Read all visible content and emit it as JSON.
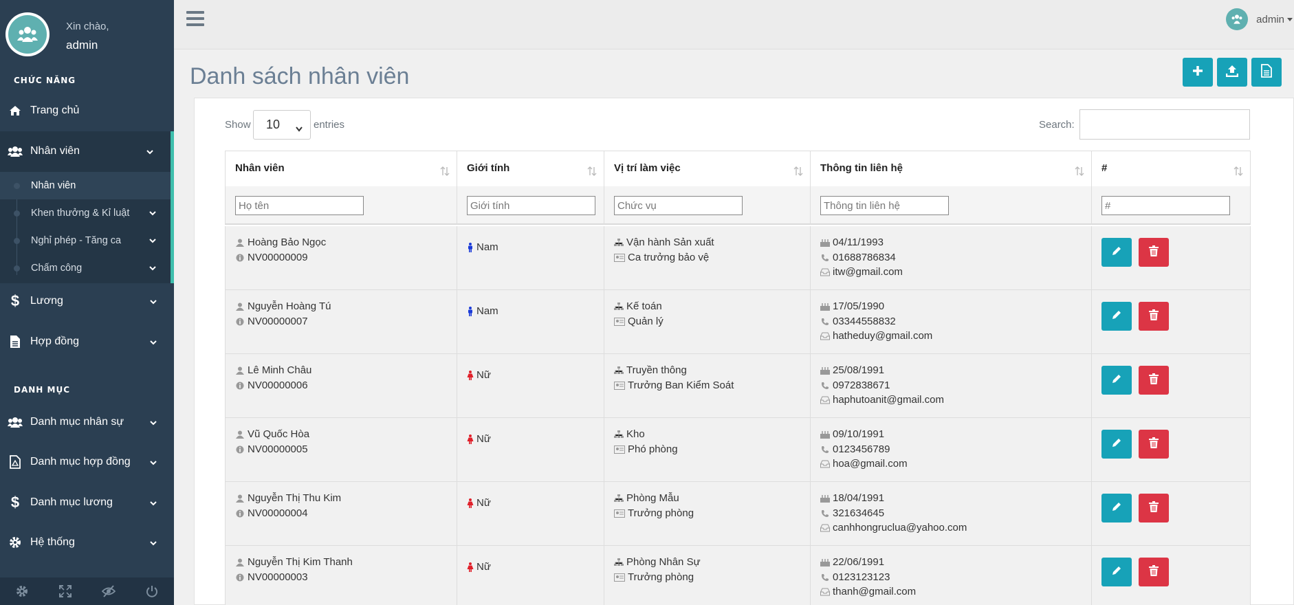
{
  "colors": {
    "sidebar": "#2b3f52",
    "accent": "#17a2b8",
    "danger": "#dc3545",
    "active_border": "#3fbfad"
  },
  "sidebar": {
    "greeting": "Xin chào,",
    "username": "admin",
    "section_functions": "CHỨC NĂNG",
    "section_catalog": "DANH MỤC",
    "items": [
      {
        "label": "Trang chủ",
        "icon": "home-icon"
      },
      {
        "label": "Nhân viên",
        "icon": "users-icon"
      },
      {
        "label": "Lương",
        "icon": "dollar-icon"
      },
      {
        "label": "Hợp đồng",
        "icon": "file-icon"
      },
      {
        "label": "Danh mục nhân sự",
        "icon": "users-icon"
      },
      {
        "label": "Danh mục hợp đồng",
        "icon": "pdf-file-icon"
      },
      {
        "label": "Danh mục lương",
        "icon": "dollar-icon"
      },
      {
        "label": "Hệ thống",
        "icon": "gear-icon"
      }
    ],
    "sub_items": [
      {
        "label": "Nhân viên"
      },
      {
        "label": "Khen thưởng & Kỉ luật"
      },
      {
        "label": "Nghỉ phép - Tăng ca"
      },
      {
        "label": "Chấm công"
      }
    ]
  },
  "topbar": {
    "username": "admin"
  },
  "page": {
    "title": "Danh sách nhân viên",
    "show_label": "Show",
    "entries_value": "10",
    "entries_label": "entries",
    "search_label": "Search:"
  },
  "table": {
    "headers": [
      "Nhân viên",
      "Giới tính",
      "Vị trí làm việc",
      "Thông tin liên hệ",
      "#"
    ],
    "filters": [
      "Họ tên",
      "Giới tính",
      "Chức vụ",
      "Thông tin liên hệ",
      "#"
    ],
    "rows": [
      {
        "name": "Hoàng Bảo Ngọc",
        "id": "NV00000009",
        "gender": "Nam",
        "dept": "Vận hành Sản xuất",
        "role": "Ca trưởng bảo vệ",
        "dob": "04/11/1993",
        "phone": "01688786834",
        "email": "itw@gmail.com"
      },
      {
        "name": "Nguyễn Hoàng Tú",
        "id": "NV00000007",
        "gender": "Nam",
        "dept": "Kế toán",
        "role": "Quản lý",
        "dob": "17/05/1990",
        "phone": "03344558832",
        "email": "hatheduy@gmail.com"
      },
      {
        "name": "Lê Minh Châu",
        "id": "NV00000006",
        "gender": "Nữ",
        "dept": "Truyền thông",
        "role": "Trưởng Ban Kiểm Soát",
        "dob": "25/08/1991",
        "phone": "0972838671",
        "email": "haphutoanit@gmail.com"
      },
      {
        "name": "Vũ Quốc Hòa",
        "id": "NV00000005",
        "gender": "Nữ",
        "dept": "Kho",
        "role": "Phó phòng",
        "dob": "09/10/1991",
        "phone": "0123456789",
        "email": "hoa@gmail.com"
      },
      {
        "name": "Nguyễn Thị Thu Kim",
        "id": "NV00000004",
        "gender": "Nữ",
        "dept": "Phòng Mẫu",
        "role": "Trưởng phòng",
        "dob": "18/04/1991",
        "phone": "321634645",
        "email": "canhhongruclua@yahoo.com"
      },
      {
        "name": "Nguyễn Thị Kim Thanh",
        "id": "NV00000003",
        "gender": "Nữ",
        "dept": "Phòng Nhân Sự",
        "role": "Trưởng phòng",
        "dob": "22/06/1991",
        "phone": "0123123123",
        "email": "thanh@gmail.com"
      }
    ]
  }
}
